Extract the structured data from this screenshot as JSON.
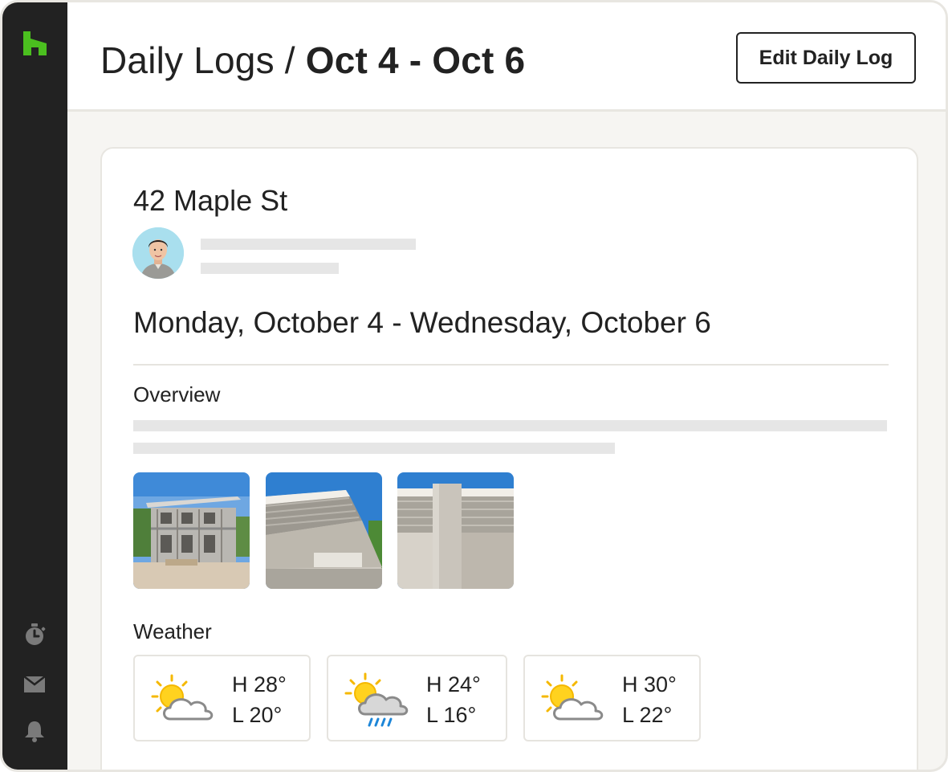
{
  "app": {
    "brand_color": "#4bbf1f",
    "sidebar_color": "#222222"
  },
  "sidebar": {
    "logo": "houzz-logo",
    "icons": [
      "stopwatch-icon",
      "inbox-icon",
      "bell-icon"
    ]
  },
  "header": {
    "title_prefix": "Daily Logs / ",
    "title_dates": "Oct 4 - Oct 6",
    "edit_button": "Edit Daily Log"
  },
  "log": {
    "address": "42 Maple St",
    "date_range": "Monday, October 4 - Wednesday, October 6",
    "overview_label": "Overview",
    "weather_label": "Weather",
    "photos": [
      "house-under-construction",
      "concrete-eave",
      "concrete-column"
    ],
    "weather": [
      {
        "icon": "partly-cloudy-icon",
        "high": "H 28°",
        "low": "L 20°"
      },
      {
        "icon": "rain-icon",
        "high": "H 24°",
        "low": "L 16°"
      },
      {
        "icon": "partly-cloudy-icon",
        "high": "H 30°",
        "low": "L 22°"
      }
    ]
  }
}
